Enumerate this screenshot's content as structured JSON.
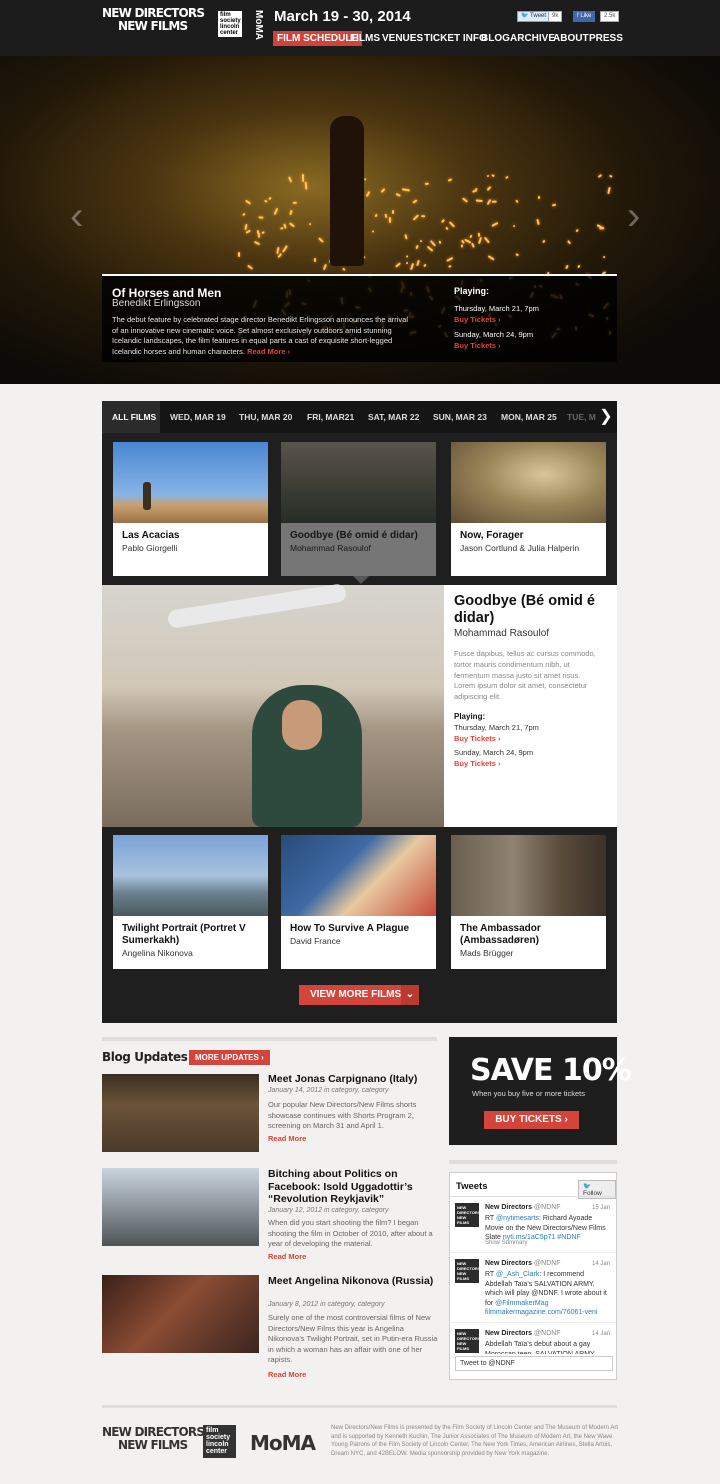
{
  "header": {
    "logo_line1": "New Directors",
    "logo_line2": "New Films",
    "fslc": [
      "film",
      "society",
      "lincoln",
      "center"
    ],
    "moma_vertical": "MoMA",
    "dates": "March 19 - 30, 2014",
    "tweet_label": "Tweet",
    "tweet_count": "9k",
    "like_label": "Like",
    "like_count": "2.5k",
    "nav": [
      "FILM SCHEDULE",
      "FILMS",
      "VENUES",
      "TICKET INFO",
      "BLOG",
      "ARCHIVE",
      "ABOUT",
      "PRESS"
    ]
  },
  "hero": {
    "title": "Of Horses and Men",
    "director": "Benedikt Erlingsson",
    "description": "The debut feature by celebrated stage director Benedikt Erlingsson announces the arrival of an innovative new cinematic voice. Set almost exclusively outdoors amid stunning Icelandic landscapes, the film features in equal parts a cast of exquisite short-legged Icelandic horses and human characters.",
    "read_more": "Read More",
    "playing_label": "Playing:",
    "showtimes": [
      {
        "time": "Thursday, March 21, 7pm",
        "buy": "Buy Tickets"
      },
      {
        "time": "Sunday, March 24, 9pm",
        "buy": "Buy Tickets"
      }
    ]
  },
  "films": {
    "tabs": [
      "ALL FILMS",
      "WED, MAR 19",
      "THU, MAR 20",
      "FRI, MAR21",
      "SAT, MAR 22",
      "SUN, MAR 23",
      "MON, MAR 25",
      "TUE, M"
    ],
    "row1": [
      {
        "title": "Las Acacias",
        "director": "Pablo Giorgelli"
      },
      {
        "title": "Goodbye (Bé omid é didar)",
        "director": "Mohammad Rasoulof"
      },
      {
        "title": "Now, Forager",
        "director": "Jason Cortlund & Julia Halperin"
      }
    ],
    "featured": {
      "title": "Goodbye (Bé omid é didar)",
      "director": "Mohammad Rasoulof",
      "description": "Fusce dapibus, tellus ac cursus commodo, tortor mauris condimentum nibh, ut fermentum massa justo sit amet risus. Lorem ipsum dolor sit amet, consectetur adipiscing elit.",
      "playing_label": "Playing:",
      "showtimes": [
        {
          "time": "Thursday, March 21, 7pm",
          "buy": "Buy Tickets"
        },
        {
          "time": "Sunday, March 24, 9pm",
          "buy": "Buy Tickets"
        }
      ]
    },
    "row2": [
      {
        "title": "Twilight Portrait (Portret V Sumerkakh)",
        "director": "Angelina Nikonova"
      },
      {
        "title": "How To Survive A Plague",
        "director": "David France"
      },
      {
        "title": "The Ambassador (Ambassadøren)",
        "director": "Mads Brügger"
      }
    ],
    "view_more": "VIEW MORE FILMS"
  },
  "blog": {
    "heading": "Blog Updates",
    "more_updates": "MORE UPDATES",
    "posts": [
      {
        "title": "Meet Jonas Carpignano (Italy)",
        "meta": "January 14, 2012 in category, category",
        "excerpt": "Our popular New Directors/New Films shorts showcase continues with Shorts Program 2, screening on March 31 and April 1.",
        "read_more": "Read More"
      },
      {
        "title": "Bitching about Politics on Facebook: Isold Uggadottir’s “Revolution Reykjavik”",
        "meta": "January 12, 2012 in category, category",
        "excerpt": "When did you start shooting the film? I began shooting the film in October of 2010, after about a year of developing the material.",
        "read_more": "Read More"
      },
      {
        "title": "Meet Angelina Nikonova (Russia)",
        "meta": "January 8, 2012 in category, category",
        "excerpt": "Surely one of the most controversial films of New Directors/New Films this year is Angelina Nikonova’s Twilight Portrait, set in Putin-era Russia in which a woman has an affair with one of her rapists.",
        "read_more": "Read More"
      }
    ]
  },
  "promo": {
    "headline": "SAVE 10%",
    "subline": "When you buy five or more tickets",
    "button": "BUY TICKETS"
  },
  "tweets": {
    "heading": "Tweets",
    "follow": "Follow",
    "items": [
      {
        "name": "New Directors",
        "handle": "@NDNF",
        "date": "15 Jan",
        "text_pre": "RT ",
        "mention": "@nytimesarts",
        "text_post": ": Richard Ayoade Movie on the New Directors/New Films Slate ",
        "link": "nyti.ms/1aC5p71 #NDNF",
        "extra": "Show Summary"
      },
      {
        "name": "New Directors",
        "handle": "@NDNF",
        "date": "14 Jan",
        "text_pre": "RT ",
        "mention": "@_Ash_Clark",
        "text_post": ": I recommend Abdellah Taïa’s SALVATION ARMY, which will play @NDNF. I wrote about it for ",
        "link": "@FilmmakerMag filmmakermagazine.com/76061-veni",
        "extra": ""
      },
      {
        "name": "New Directors",
        "handle": "@NDNF",
        "date": "14 Jan",
        "text_pre": "",
        "mention": "",
        "text_post": "Abdellah Taïa’s debut about a gay Moroccan teen, SALVATION ARMY,",
        "link": "",
        "extra": ""
      }
    ],
    "input_value": "Tweet to @NDNF"
  },
  "footer": {
    "logo_line1": "New Directors",
    "logo_line2": "New Films",
    "fslc": [
      "film",
      "society",
      "lincoln",
      "center"
    ],
    "moma": "MoMA",
    "text": "New Directors/New Films is presented by the Film Society of Lincoln Center and The Museum of Modern Art and is supported by Kenneth Kuchin, The Junior Associates of The Museum of Modern Art, the New Wave Young Patrons of the Film Society of Lincoln Center, The New York Times, American Airlines, Stella Artois, Dream NYC, and 42BELOW. Media sponsorship provided by New York magazine."
  },
  "colors": {
    "accent": "#d3453a",
    "dark": "#1c1c1c",
    "page_bg": "#f2f1ef"
  }
}
